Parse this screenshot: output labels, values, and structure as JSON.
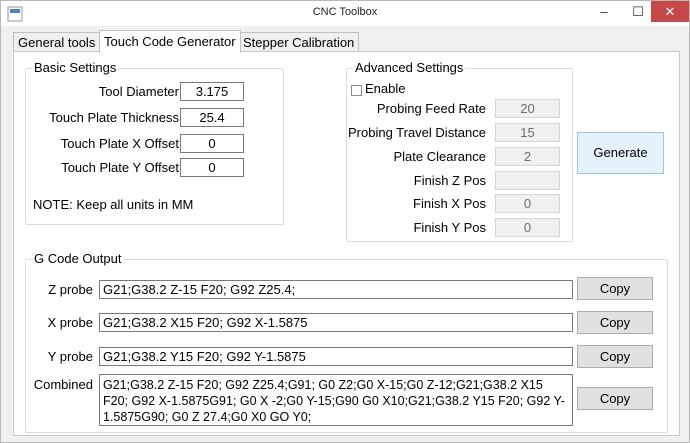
{
  "window": {
    "title": "CNC Toolbox",
    "minimize": "–",
    "maximize": "☐",
    "close": "✕"
  },
  "tabs": [
    "General tools",
    "Touch Code Generator",
    "Stepper Calibration"
  ],
  "basic": {
    "title": "Basic Settings",
    "tool_diameter_label": "Tool Diameter",
    "tool_diameter": "3.175",
    "plate_thickness_label": "Touch Plate Thickness",
    "plate_thickness": "25.4",
    "x_offset_label": "Touch Plate X Offset",
    "x_offset": "0",
    "y_offset_label": "Touch Plate Y Offset",
    "y_offset": "0",
    "note": "NOTE: Keep all units in MM"
  },
  "advanced": {
    "title": "Advanced Settings",
    "enable_label": "Enable",
    "feed_rate_label": "Probing Feed Rate",
    "feed_rate": "20",
    "travel_label": "Probing Travel Distance",
    "travel": "15",
    "clearance_label": "Plate Clearance",
    "clearance": "2",
    "finish_z_label": "Finish Z Pos",
    "finish_z": "",
    "finish_x_label": "Finish X Pos",
    "finish_x": "0",
    "finish_y_label": "Finish Y Pos",
    "finish_y": "0"
  },
  "generate_label": "Generate",
  "output": {
    "title": "G Code Output",
    "z_label": "Z probe",
    "z_code": "G21;G38.2 Z-15 F20; G92 Z25.4;",
    "x_label": "X probe",
    "x_code": "G21;G38.2 X15 F20; G92 X-1.5875",
    "y_label": "Y probe",
    "y_code": "G21;G38.2 Y15 F20; G92 Y-1.5875",
    "combined_label": "Combined",
    "combined_code": "G21;G38.2 Z-15 F20; G92 Z25.4;G91; G0 Z2;G0 X-15;G0 Z-12;G21;G38.2 X15 F20; G92 X-1.5875G91; G0 X -2;G0 Y-15;G90 G0 X10;G21;G38.2 Y15 F20; G92 Y-1.5875G90; G0 Z 27.4;G0 X0 GO Y0;",
    "copy_label": "Copy"
  }
}
